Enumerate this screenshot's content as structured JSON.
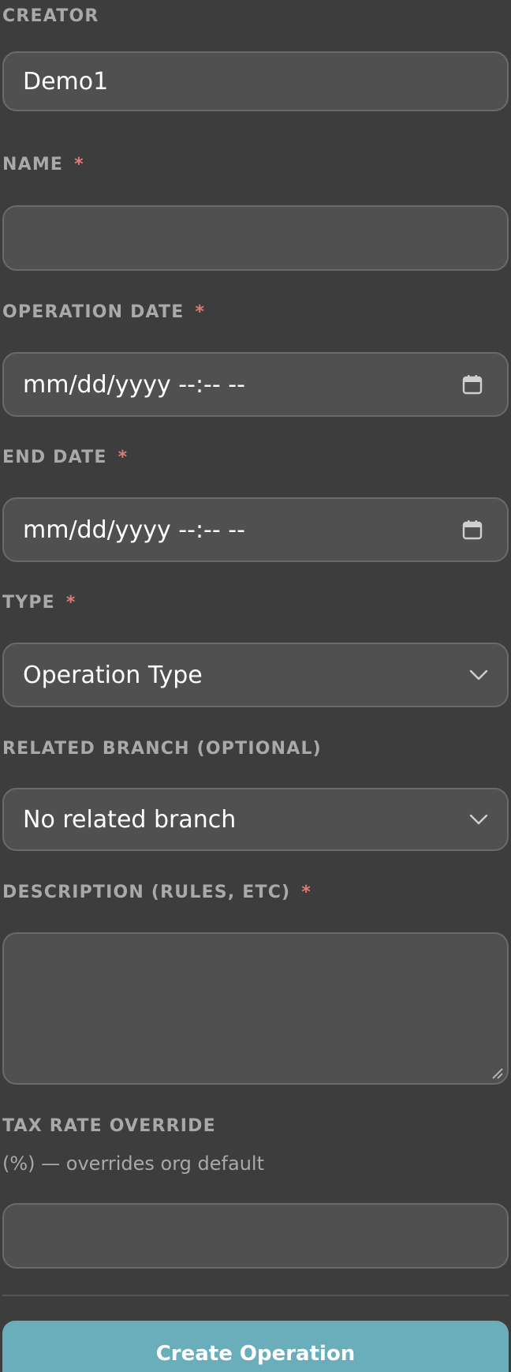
{
  "form": {
    "creator": {
      "label": "CREATOR",
      "value": "Demo1"
    },
    "name": {
      "label": "NAME",
      "required_mark": "*",
      "value": ""
    },
    "operation_date": {
      "label": "OPERATION DATE",
      "required_mark": "*",
      "placeholder": "mm/dd/yyyy --:-- --",
      "icon": "calendar-icon"
    },
    "end_date": {
      "label": "END DATE",
      "required_mark": "*",
      "placeholder": "mm/dd/yyyy --:-- --",
      "icon": "calendar-icon"
    },
    "type": {
      "label": "TYPE",
      "required_mark": "*",
      "selected": "Operation Type",
      "icon": "chevron-down-icon"
    },
    "related_branch": {
      "label": "RELATED BRANCH (OPTIONAL)",
      "selected": "No related branch",
      "icon": "chevron-down-icon"
    },
    "description": {
      "label": "DESCRIPTION (RULES, ETC)",
      "required_mark": "*",
      "value": ""
    },
    "tax_rate_override": {
      "label": "TAX RATE OVERRIDE",
      "hint": "(%) — overrides org default",
      "value": ""
    },
    "submit_label": "Create Operation"
  },
  "colors": {
    "background": "#3d3d3d",
    "field_background": "#505050",
    "field_border": "#6a6a6a",
    "label": "#a9a9a9",
    "required": "#e07a75",
    "primary_button": "#6aaebb",
    "text": "#ffffff"
  }
}
